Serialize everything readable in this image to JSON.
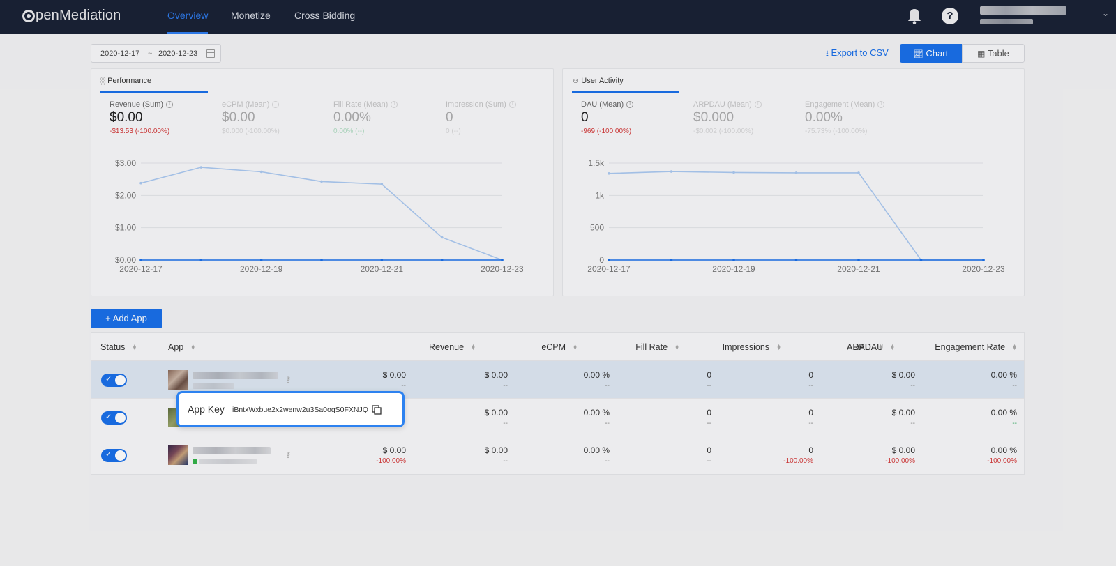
{
  "header": {
    "logo": "penMediation",
    "nav": [
      "Overview",
      "Monetize",
      "Cross Bidding"
    ]
  },
  "toolbar": {
    "date_start": "2020-12-17",
    "date_sep": "~",
    "date_end": "2020-12-23",
    "export_label": "Export to CSV",
    "chart_label": "Chart",
    "table_label": "Table"
  },
  "performance": {
    "tab": "Performance",
    "metrics": [
      {
        "label": "Revenue (Sum)",
        "value": "$0.00",
        "change": "-$13.53  (-100.00%)"
      },
      {
        "label": "eCPM (Mean)",
        "value": "$0.00",
        "change": "$0.000  (-100.00%)"
      },
      {
        "label": "Fill Rate (Mean)",
        "value": "0.00%",
        "change": "0.00%  (--)"
      },
      {
        "label": "Impression (Sum)",
        "value": "0",
        "change": "0  (--)"
      }
    ]
  },
  "user_activity": {
    "tab": "User Activity",
    "metrics": [
      {
        "label": "DAU (Mean)",
        "value": "0",
        "change": "-969  (-100.00%)"
      },
      {
        "label": "ARPDAU (Mean)",
        "value": "$0.000",
        "change": "-$0.002  (-100.00%)"
      },
      {
        "label": "Engagement (Mean)",
        "value": "0.00%",
        "change": "-75.73%  (-100.00%)"
      }
    ]
  },
  "chart_data": [
    {
      "type": "line",
      "x": [
        "2020-12-17",
        "2020-12-18",
        "2020-12-19",
        "2020-12-20",
        "2020-12-21",
        "2020-12-22",
        "2020-12-23"
      ],
      "xticks": [
        "2020-12-17",
        "2020-12-19",
        "2020-12-21",
        "2020-12-23"
      ],
      "yticks": [
        "$3.00",
        "$2.00",
        "$1.00",
        "$0.00"
      ],
      "ylim": [
        0,
        3
      ],
      "series": [
        {
          "values": [
            2.38,
            2.87,
            2.73,
            2.43,
            2.35,
            0.7,
            0.0
          ],
          "color": "#aac8f0"
        },
        {
          "values": [
            0,
            0,
            0,
            0,
            0,
            0,
            0
          ],
          "color": "#1a6fe8"
        }
      ]
    },
    {
      "type": "line",
      "x": [
        "2020-12-17",
        "2020-12-18",
        "2020-12-19",
        "2020-12-20",
        "2020-12-21",
        "2020-12-22",
        "2020-12-23"
      ],
      "xticks": [
        "2020-12-17",
        "2020-12-19",
        "2020-12-21",
        "2020-12-23"
      ],
      "yticks": [
        "1.5k",
        "1k",
        "500",
        "0"
      ],
      "ylim": [
        0,
        1500
      ],
      "series": [
        {
          "values": [
            1340,
            1370,
            1355,
            1350,
            1350,
            0,
            0
          ],
          "color": "#aac8f0"
        },
        {
          "values": [
            0,
            0,
            0,
            0,
            0,
            0,
            0
          ],
          "color": "#1a6fe8"
        }
      ]
    }
  ],
  "add_app_label": "+ Add App",
  "table": {
    "columns": [
      "Status",
      "App",
      "Revenue",
      "eCPM",
      "Fill Rate",
      "Impressions",
      "DAU",
      "ARPDAU",
      "Engagement Rate"
    ],
    "rows": [
      {
        "revenue": "$ 0.00",
        "revenue_sub": "--",
        "ecpm": "$ 0.00",
        "ecpm_sub": "--",
        "fill": "0.00 %",
        "fill_sub": "--",
        "imp": "0",
        "imp_sub": "--",
        "dau": "0",
        "dau_sub": "--",
        "arpdau": "$ 0.00",
        "arpdau_sub": "--",
        "eng": "0.00 %",
        "eng_sub": "--"
      },
      {
        "revenue": "",
        "revenue_sub": "",
        "ecpm": "$ 0.00",
        "ecpm_sub": "--",
        "fill": "0.00 %",
        "fill_sub": "--",
        "imp": "0",
        "imp_sub": "--",
        "dau": "0",
        "dau_sub": "--",
        "arpdau": "$ 0.00",
        "arpdau_sub": "--",
        "eng": "0.00 %",
        "eng_sub": "--"
      },
      {
        "revenue": "$ 0.00",
        "revenue_sub": "-100.00%",
        "ecpm": "$ 0.00",
        "ecpm_sub": "--",
        "fill": "0.00 %",
        "fill_sub": "--",
        "imp": "0",
        "imp_sub": "--",
        "dau": "0",
        "dau_sub": "-100.00%",
        "arpdau": "$ 0.00",
        "arpdau_sub": "-100.00%",
        "eng": "0.00 %",
        "eng_sub": "-100.00%"
      }
    ]
  },
  "popover": {
    "title": "App Key",
    "key": "iBntxWxbue2x2wenw2u3Sa0oqS0FXNJQ"
  }
}
